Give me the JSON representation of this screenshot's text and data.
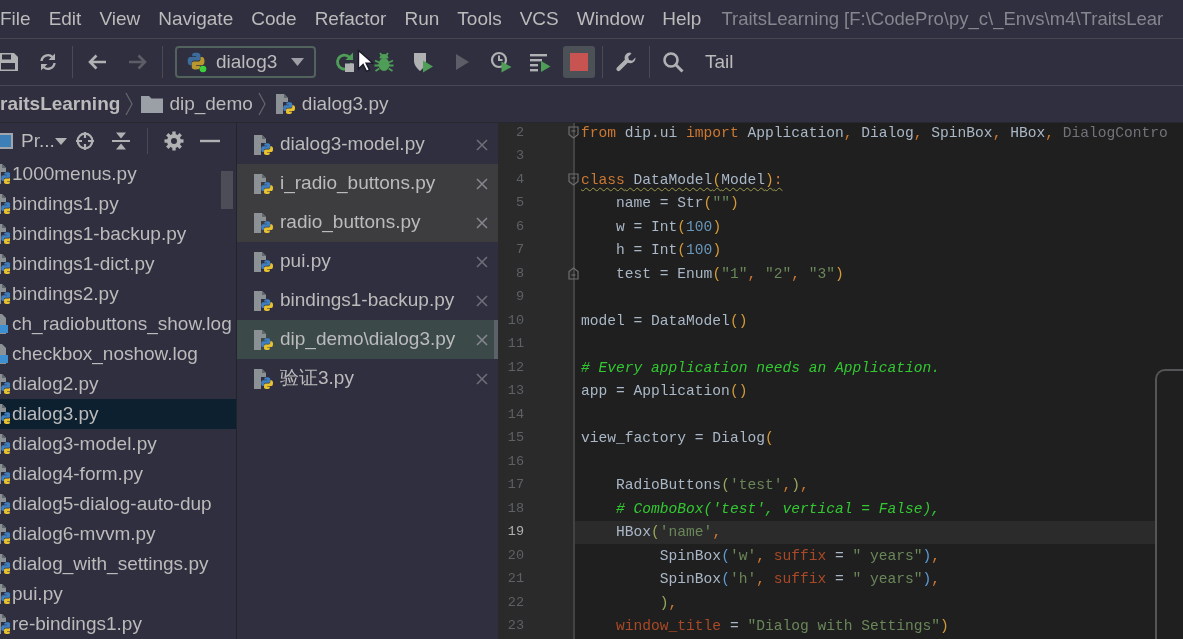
{
  "menu_bar": {
    "items": [
      "File",
      "Edit",
      "View",
      "Navigate",
      "Code",
      "Refactor",
      "Run",
      "Tools",
      "VCS",
      "Window",
      "Help"
    ],
    "title": "TraitsLearning [F:\\CodePro\\py_c\\_Envs\\m4\\TraitsLear"
  },
  "toolbar": {
    "groups": [
      [
        {
          "kind": "save",
          "disabled": false
        },
        {
          "kind": "sync",
          "disabled": false
        }
      ],
      [
        {
          "kind": "back",
          "disabled": false
        },
        {
          "kind": "forward",
          "disabled": true
        }
      ],
      [
        {
          "kind": "run_config",
          "label": "dialog3",
          "disabled": false
        },
        {
          "kind": "rerun",
          "disabled": false
        },
        {
          "kind": "debug",
          "disabled": false
        },
        {
          "kind": "coverage",
          "disabled": false
        },
        {
          "kind": "run",
          "disabled": true
        },
        {
          "kind": "profile",
          "disabled": false
        },
        {
          "kind": "concurrency",
          "disabled": false
        },
        {
          "kind": "stop",
          "disabled": false
        }
      ],
      [
        {
          "kind": "settings",
          "disabled": false
        }
      ],
      [
        {
          "kind": "search",
          "disabled": false
        },
        {
          "kind": "text",
          "label": "Tail",
          "disabled": false
        }
      ]
    ]
  },
  "breadcrumb": [
    {
      "kind": "project",
      "label": "raitsLearning"
    },
    {
      "kind": "folder",
      "label": "dip_demo"
    },
    {
      "kind": "python_file",
      "label": "dialog3.py"
    }
  ],
  "project_panel": {
    "title": "Pr...",
    "files": [
      {
        "name": "1000menus.py",
        "kind": "python",
        "selected": false
      },
      {
        "name": "bindings1.py",
        "kind": "python",
        "selected": false
      },
      {
        "name": "bindings1-backup.py",
        "kind": "python",
        "selected": false
      },
      {
        "name": "bindings1-dict.py",
        "kind": "python",
        "selected": false
      },
      {
        "name": "bindings2.py",
        "kind": "python",
        "selected": false
      },
      {
        "name": "ch_radiobuttons_show.log",
        "kind": "log",
        "selected": false
      },
      {
        "name": "checkbox_noshow.log",
        "kind": "log",
        "selected": false
      },
      {
        "name": "dialog2.py",
        "kind": "python",
        "selected": false
      },
      {
        "name": "dialog3.py",
        "kind": "python",
        "selected": true
      },
      {
        "name": "dialog3-model.py",
        "kind": "python",
        "selected": false
      },
      {
        "name": "dialog4-form.py",
        "kind": "python",
        "selected": false
      },
      {
        "name": "dialog5-dialog-auto-dup",
        "kind": "python",
        "selected": false
      },
      {
        "name": "dialog6-mvvm.py",
        "kind": "python",
        "selected": false
      },
      {
        "name": "dialog_with_settings.py",
        "kind": "python",
        "selected": false
      },
      {
        "name": "pui.py",
        "kind": "python",
        "selected": false
      },
      {
        "name": "re-bindings1.py",
        "kind": "python",
        "selected": false
      }
    ]
  },
  "recent_files": {
    "items": [
      {
        "name": "dialog3-model.py",
        "highlighted": false,
        "selected": false
      },
      {
        "name": "i_radio_buttons.py",
        "highlighted": true,
        "selected": false
      },
      {
        "name": "radio_buttons.py",
        "highlighted": true,
        "selected": false
      },
      {
        "name": "pui.py",
        "highlighted": false,
        "selected": false
      },
      {
        "name": "bindings1-backup.py",
        "highlighted": false,
        "selected": false
      },
      {
        "name": "dip_demo\\dialog3.py",
        "highlighted": false,
        "selected": true
      },
      {
        "name": "验证3.py",
        "highlighted": false,
        "selected": false
      }
    ]
  },
  "editor": {
    "lines": [
      {
        "number": "2",
        "current": false,
        "warning": false,
        "fold": {
          "kind": "start"
        },
        "tokens": [
          {
            "kind": "keyword",
            "text": "from"
          },
          {
            "kind": "plain",
            "text": " dip.ui "
          },
          {
            "kind": "keyword",
            "text": "import"
          },
          {
            "kind": "plain",
            "text": " Application"
          },
          {
            "kind": "punct",
            "text": ", "
          },
          {
            "kind": "plain",
            "text": "Dialog"
          },
          {
            "kind": "punct",
            "text": ", "
          },
          {
            "kind": "plain",
            "text": "SpinBox"
          },
          {
            "kind": "punct",
            "text": ", "
          },
          {
            "kind": "plain",
            "text": "HBox"
          },
          {
            "kind": "punct",
            "text": ", "
          },
          {
            "kind": "unused",
            "text": "DialogContro"
          }
        ]
      },
      {
        "number": "3",
        "current": false
      },
      {
        "number": "4",
        "current": false,
        "warning": true,
        "fold": {
          "kind": "start"
        },
        "tokens": [
          {
            "kind": "keyword",
            "text": "class"
          },
          {
            "kind": "plain",
            "text": " DataModel"
          },
          {
            "kind": "bracket1",
            "text": "("
          },
          {
            "kind": "plain",
            "text": "Model"
          },
          {
            "kind": "bracket1",
            "text": ")"
          },
          {
            "kind": "punct",
            "text": ":"
          }
        ]
      },
      {
        "number": "5",
        "current": false,
        "warning": false,
        "tokens": [
          {
            "kind": "plain",
            "text": "    name = Str"
          },
          {
            "kind": "bracket1",
            "text": "("
          },
          {
            "kind": "string",
            "text": "\"\""
          },
          {
            "kind": "bracket1",
            "text": ")"
          }
        ]
      },
      {
        "number": "6",
        "current": false,
        "warning": false,
        "tokens": [
          {
            "kind": "plain",
            "text": "    w = Int"
          },
          {
            "kind": "bracket1",
            "text": "("
          },
          {
            "kind": "number",
            "text": "100"
          },
          {
            "kind": "bracket1",
            "text": ")"
          }
        ]
      },
      {
        "number": "7",
        "current": false,
        "warning": false,
        "tokens": [
          {
            "kind": "plain",
            "text": "    h = Int"
          },
          {
            "kind": "bracket1",
            "text": "("
          },
          {
            "kind": "number",
            "text": "100"
          },
          {
            "kind": "bracket1",
            "text": ")"
          }
        ]
      },
      {
        "number": "8",
        "current": false,
        "warning": false,
        "fold": {
          "kind": "end"
        },
        "tokens": [
          {
            "kind": "plain",
            "text": "    test = Enum"
          },
          {
            "kind": "bracket1",
            "text": "("
          },
          {
            "kind": "string",
            "text": "\"1\""
          },
          {
            "kind": "punct",
            "text": ", "
          },
          {
            "kind": "string",
            "text": "\"2\""
          },
          {
            "kind": "punct",
            "text": ", "
          },
          {
            "kind": "string",
            "text": "\"3\""
          },
          {
            "kind": "bracket1",
            "text": ")"
          }
        ]
      },
      {
        "number": "9",
        "current": false
      },
      {
        "number": "10",
        "current": false,
        "warning": false,
        "tokens": [
          {
            "kind": "plain",
            "text": "model = DataModel"
          },
          {
            "kind": "bracket1",
            "text": "()"
          }
        ]
      },
      {
        "number": "11",
        "current": false
      },
      {
        "number": "12",
        "current": false,
        "warning": false,
        "tokens": [
          {
            "kind": "comment",
            "text": "# Every application needs an Application."
          }
        ]
      },
      {
        "number": "13",
        "current": false,
        "warning": false,
        "tokens": [
          {
            "kind": "plain",
            "text": "app = Application"
          },
          {
            "kind": "bracket1",
            "text": "()"
          }
        ]
      },
      {
        "number": "14",
        "current": false
      },
      {
        "number": "15",
        "current": false,
        "warning": false,
        "tokens": [
          {
            "kind": "plain",
            "text": "view_factory = Dialog"
          },
          {
            "kind": "bracket1",
            "text": "("
          }
        ]
      },
      {
        "number": "16",
        "current": false
      },
      {
        "number": "17",
        "current": false,
        "warning": false,
        "tokens": [
          {
            "kind": "plain",
            "text": "    RadioButtons"
          },
          {
            "kind": "bracket2",
            "text": "("
          },
          {
            "kind": "string",
            "text": "'test'"
          },
          {
            "kind": "punct",
            "text": ","
          },
          {
            "kind": "bracket2",
            "text": ")"
          },
          {
            "kind": "punct",
            "text": ","
          }
        ]
      },
      {
        "number": "18",
        "current": false,
        "warning": false,
        "tokens": [
          {
            "kind": "comment",
            "text": "    # ComboBox('test', vertical = False),"
          }
        ]
      },
      {
        "number": "19",
        "current": true,
        "warning": false,
        "tokens": [
          {
            "kind": "plain",
            "text": "    HBox"
          },
          {
            "kind": "bracket2",
            "text": "("
          },
          {
            "kind": "string",
            "text": "'name'"
          },
          {
            "kind": "punct",
            "text": ","
          }
        ]
      },
      {
        "number": "20",
        "current": false,
        "warning": false,
        "tokens": [
          {
            "kind": "plain",
            "text": "         SpinBox"
          },
          {
            "kind": "bracket3",
            "text": "("
          },
          {
            "kind": "string",
            "text": "'w'"
          },
          {
            "kind": "punct",
            "text": ", "
          },
          {
            "kind": "kwarg",
            "text": "suffix"
          },
          {
            "kind": "plain",
            "text": " = "
          },
          {
            "kind": "string",
            "text": "\" years\""
          },
          {
            "kind": "bracket3",
            "text": ")"
          },
          {
            "kind": "punct",
            "text": ","
          }
        ]
      },
      {
        "number": "21",
        "current": false,
        "warning": false,
        "tokens": [
          {
            "kind": "plain",
            "text": "         SpinBox"
          },
          {
            "kind": "bracket3",
            "text": "("
          },
          {
            "kind": "string",
            "text": "'h'"
          },
          {
            "kind": "punct",
            "text": ", "
          },
          {
            "kind": "kwarg",
            "text": "suffix"
          },
          {
            "kind": "plain",
            "text": " = "
          },
          {
            "kind": "string",
            "text": "\" years\""
          },
          {
            "kind": "bracket3",
            "text": ")"
          },
          {
            "kind": "punct",
            "text": ","
          }
        ]
      },
      {
        "number": "22",
        "current": false,
        "warning": false,
        "tokens": [
          {
            "kind": "bracket2",
            "text": "         )"
          },
          {
            "kind": "punct",
            "text": ","
          }
        ]
      },
      {
        "number": "23",
        "current": false,
        "warning": false,
        "tokens": [
          {
            "kind": "kwarg",
            "text": "    window_title"
          },
          {
            "kind": "plain",
            "text": " = "
          },
          {
            "kind": "string",
            "text": "\"Dialog with Settings\""
          },
          {
            "kind": "bracket1",
            "text": ")"
          }
        ]
      }
    ]
  }
}
